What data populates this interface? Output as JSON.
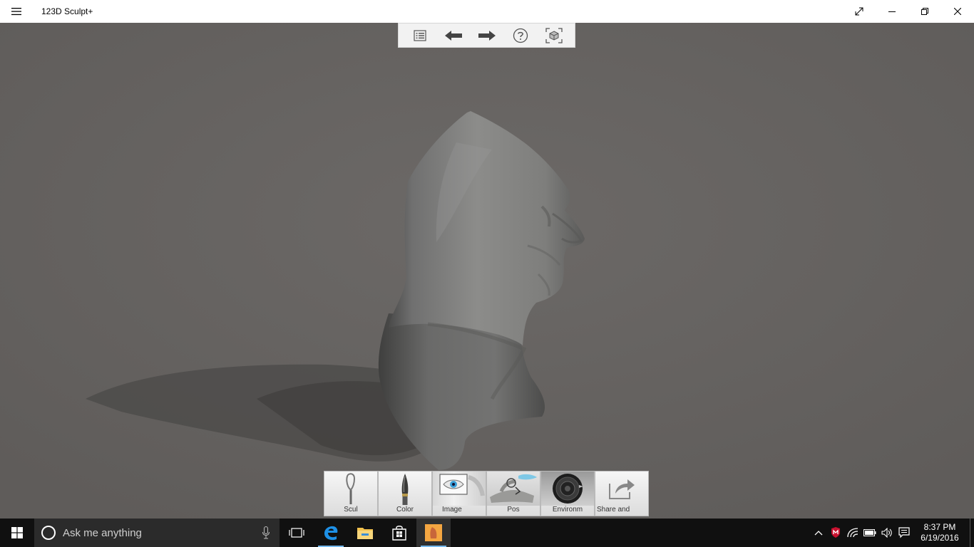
{
  "window": {
    "title": "123D Sculpt+"
  },
  "palette": {
    "tools": [
      {
        "label": "Scul"
      },
      {
        "label": "Color"
      },
      {
        "label": "Image"
      },
      {
        "label": "Pos"
      },
      {
        "label": "Environm"
      },
      {
        "label": "Share and"
      }
    ]
  },
  "taskbar": {
    "search_placeholder": "Ask me anything",
    "time": "8:37 PM",
    "date": "6/19/2016"
  },
  "colors": {
    "viewport_bg": "#666361",
    "model": "#8a8a88",
    "taskbar": "#101010",
    "accent": "#76b9ed"
  }
}
